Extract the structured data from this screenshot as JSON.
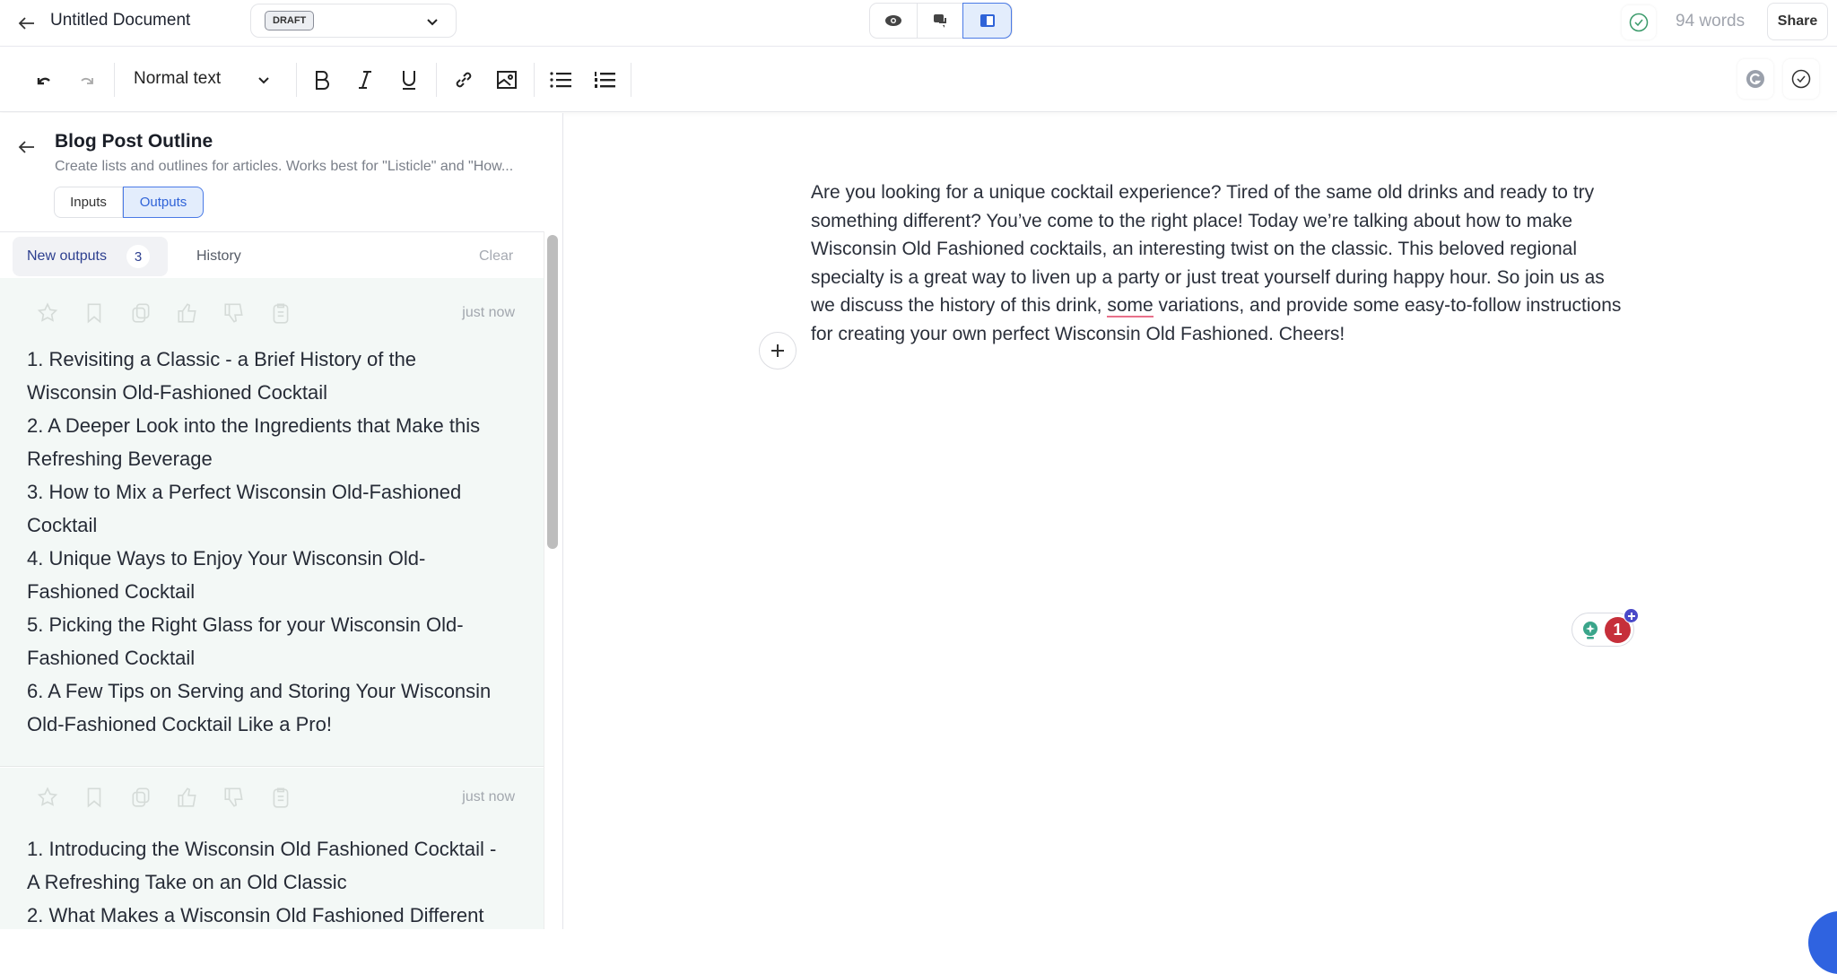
{
  "header": {
    "title": "Untitled Document",
    "status": "DRAFT",
    "word_count": "94 words",
    "share_label": "Share"
  },
  "toolbar": {
    "text_style": "Normal text"
  },
  "panel": {
    "title": "Blog Post Outline",
    "description": "Create lists and outlines for articles. Works best for \"Listicle\" and \"How...",
    "tabs": [
      {
        "label": "Inputs"
      },
      {
        "label": "Outputs"
      }
    ],
    "subtabs": {
      "new_outputs": "New outputs",
      "count": "3",
      "history": "History",
      "clear": "Clear"
    },
    "outputs": [
      {
        "time": "just now",
        "items": [
          "1. Revisiting a Classic - a Brief History of the Wisconsin Old-Fashioned Cocktail",
          "2. A Deeper Look into the Ingredients that Make this Refreshing Beverage",
          "3. How to Mix a Perfect Wisconsin Old-Fashioned Cocktail",
          "4. Unique Ways to Enjoy Your Wisconsin Old-Fashioned Cocktail",
          "5. Picking the Right Glass for your Wisconsin Old-Fashioned Cocktail",
          "6. A Few Tips on Serving and Storing Your Wisconsin Old-Fashioned Cocktail Like a Pro!"
        ]
      },
      {
        "time": "just now",
        "items": [
          "1. Introducing the Wisconsin Old Fashioned Cocktail - A Refreshing Take on an Old Classic",
          "2. What Makes a Wisconsin Old Fashioned Different"
        ]
      }
    ]
  },
  "editor": {
    "before": "Are you looking for a unique cocktail experience? Tired of the same old drinks and ready to try something different? You’ve come to the right place! Today we’re talking about how to make Wisconsin Old Fashioned cocktails, an interesting twist on the classic. This beloved regional specialty is a great way to liven up a party or just treat yourself during happy hour. So join us as we discuss the history of this drink, ",
    "flagged": "some",
    "after": " variations, and provide some easy-to-follow instructions for creating your own perfect Wisconsin Old Fashioned. Cheers!"
  },
  "assistant": {
    "issue_count": "1"
  },
  "colors": {
    "accent": "#3b6fe0",
    "accent_bg": "#e3edfc",
    "card_bg": "#f3f8f6",
    "error": "#c62f3a",
    "success": "#3aa58a"
  }
}
